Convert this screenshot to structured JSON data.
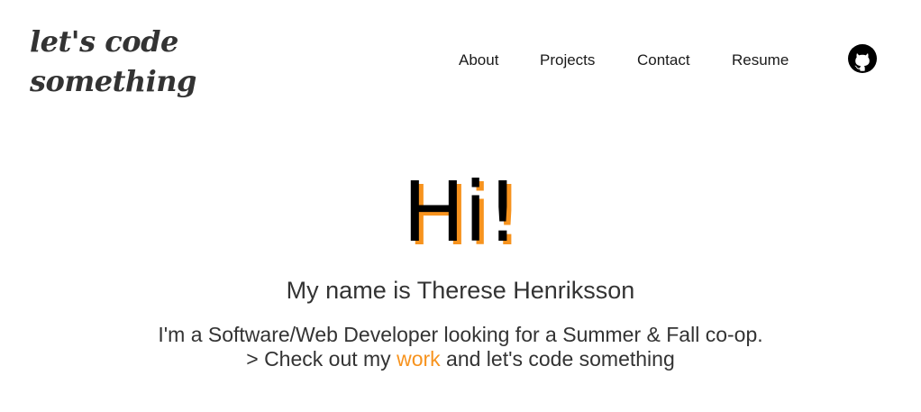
{
  "logo": {
    "line1": "let's code",
    "line2": "something"
  },
  "nav": {
    "about": "About",
    "projects": "Projects",
    "contact": "Contact",
    "resume": "Resume",
    "github_icon": "github-icon"
  },
  "hero": {
    "greeting": "Hi!",
    "name_line": "My name is Therese Henriksson",
    "description": "I'm a Software/Web Developer looking for a Summer & Fall co-op.",
    "cta_prefix": "> Check out my ",
    "cta_link": "work",
    "cta_suffix": " and let's code something"
  },
  "colors": {
    "accent": "#f7931e",
    "text": "#333333",
    "heading": "#000000"
  }
}
